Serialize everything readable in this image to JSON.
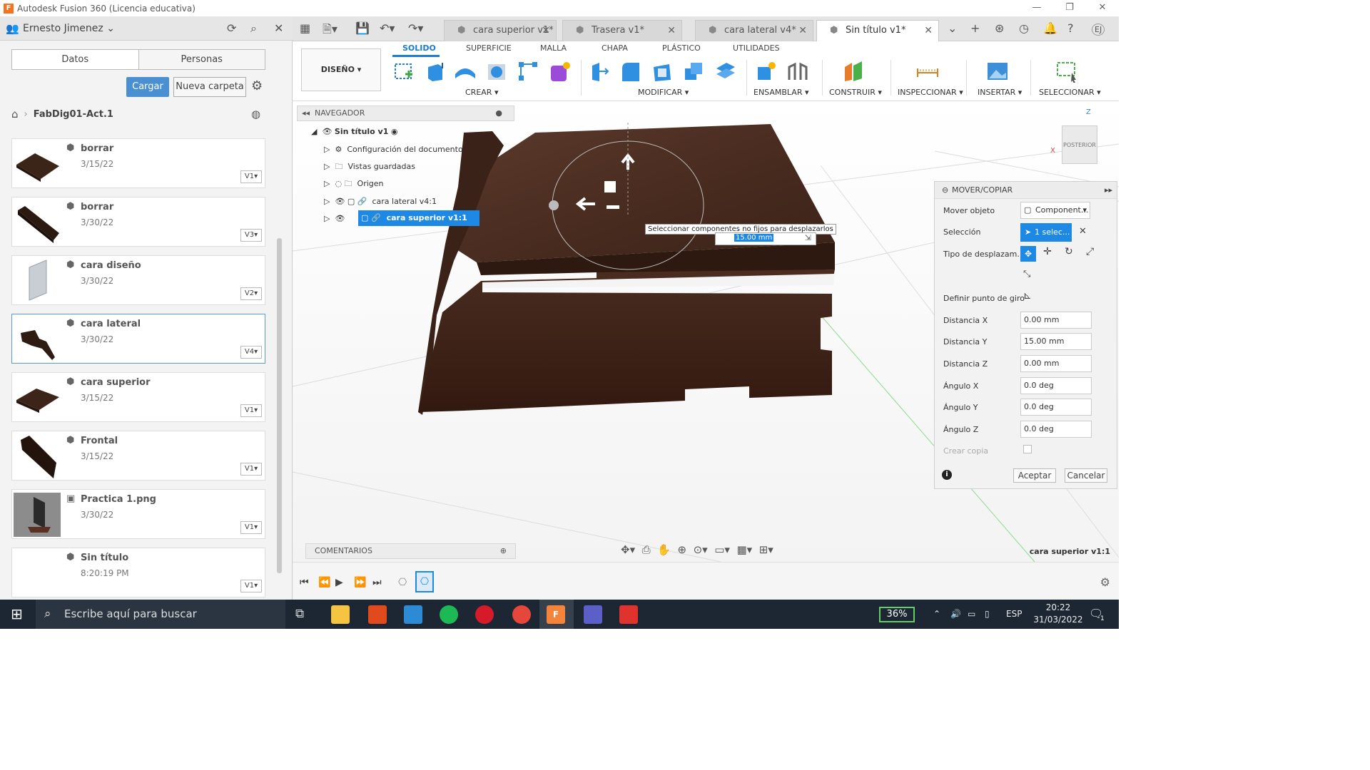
{
  "window": {
    "title": "Autodesk Fusion 360 (Licencia educativa)"
  },
  "data_panel": {
    "user": "Ernesto Jimenez",
    "tabs": [
      "Datos",
      "Personas"
    ],
    "upload_label": "Cargar",
    "new_folder_label": "Nueva carpeta",
    "breadcrumb": "FabDig01-Act.1",
    "files": [
      {
        "name": "borrar",
        "date": "3/15/22",
        "version": "V1"
      },
      {
        "name": "borrar",
        "date": "3/30/22",
        "version": "V3"
      },
      {
        "name": "cara diseño",
        "date": "3/30/22",
        "version": "V2"
      },
      {
        "name": "cara lateral",
        "date": "3/30/22",
        "version": "V4"
      },
      {
        "name": "cara superior",
        "date": "3/15/22",
        "version": "V1"
      },
      {
        "name": "Frontal",
        "date": "3/15/22",
        "version": "V1"
      },
      {
        "name": "Practica 1.png",
        "date": "3/30/22",
        "version": "V1"
      },
      {
        "name": "Sin título",
        "date": "8:20:19 PM",
        "version": "V1"
      }
    ]
  },
  "doc_tabs": [
    {
      "label": "cara superior v1*"
    },
    {
      "label": "Trasera v1*"
    },
    {
      "label": "cara lateral v4*"
    },
    {
      "label": "Sin título v1*"
    }
  ],
  "ribbon": {
    "workspace": "DISEÑO",
    "tabs": [
      "SOLIDO",
      "SUPERFICIE",
      "MALLA",
      "CHAPA",
      "PLÁSTICO",
      "UTILIDADES"
    ],
    "groups": [
      "CREAR",
      "MODIFICAR",
      "ENSAMBLAR",
      "CONSTRUIR",
      "INSPECCIONAR",
      "INSERTAR",
      "SELECCIONAR"
    ]
  },
  "navigator": {
    "title": "NAVEGADOR",
    "root": "Sin título v1",
    "items": [
      "Configuración del documento",
      "Vistas guardadas",
      "Origen",
      "cara lateral v4:1",
      "cara superior v1:1"
    ]
  },
  "viewport": {
    "tooltip": "Seleccionar componentes no fijos para desplazarlos",
    "distance_value": "15.00 mm",
    "viewcube_label": "POSTERIOR",
    "comments_label": "COMENTARIOS",
    "selection_name": "cara superior v1:1"
  },
  "dialog": {
    "title": "MOVER/COPIAR",
    "move_object_label": "Mover objeto",
    "move_object_value": "Component...",
    "selection_label": "Selección",
    "selection_value": "1 selec...",
    "move_type_label": "Tipo de desplazam...",
    "pivot_label": "Definir punto de giro",
    "fields": [
      {
        "label": "Distancia X",
        "value": "0.00 mm"
      },
      {
        "label": "Distancia Y",
        "value": "15.00 mm"
      },
      {
        "label": "Distancia Z",
        "value": "0.00 mm"
      },
      {
        "label": "Ángulo X",
        "value": "0.0 deg"
      },
      {
        "label": "Ángulo Y",
        "value": "0.0 deg"
      },
      {
        "label": "Ángulo Z",
        "value": "0.0 deg"
      }
    ],
    "create_copy_label": "Crear copia",
    "ok_label": "Aceptar",
    "cancel_label": "Cancelar"
  },
  "taskbar": {
    "search_placeholder": "Escribe aquí para buscar",
    "battery": "36%",
    "lang": "ESP",
    "time": "20:22",
    "date": "31/03/2022",
    "notifications": "1"
  }
}
